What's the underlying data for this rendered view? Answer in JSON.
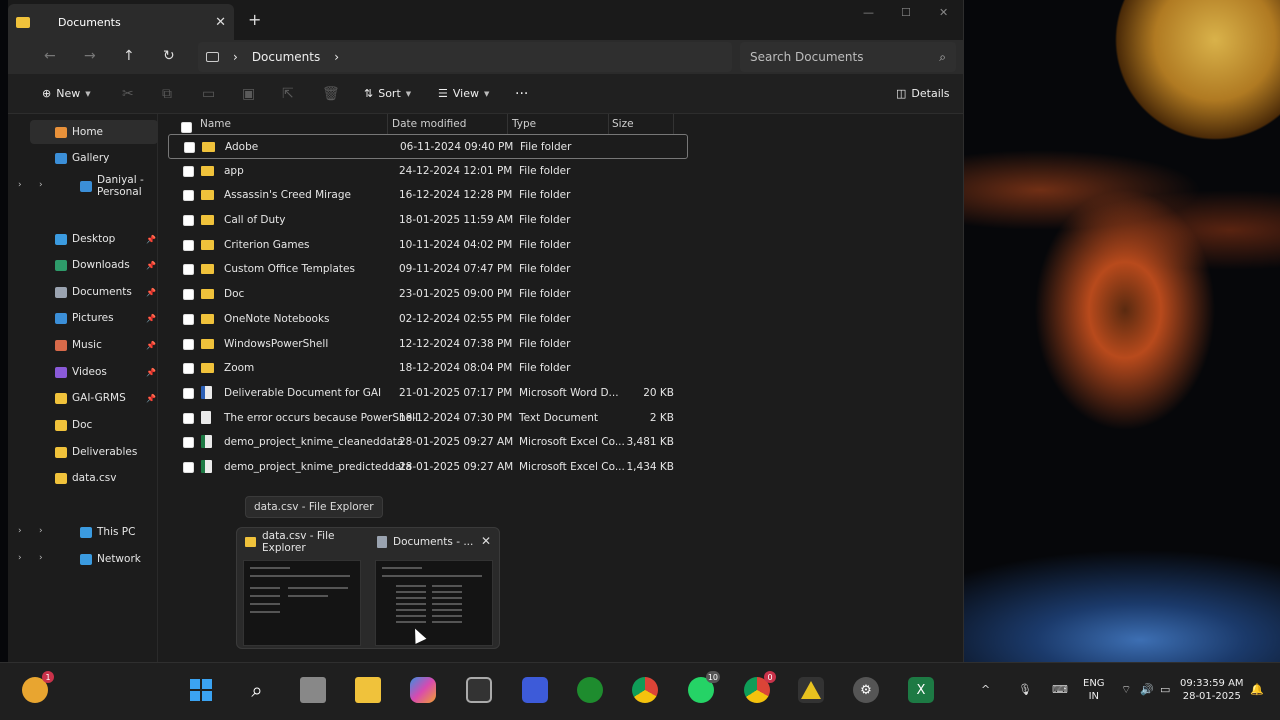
{
  "window": {
    "tab_title": "Documents",
    "new_tab": "+",
    "close_tab": "✕"
  },
  "address": {
    "breadcrumb": "Documents",
    "search_placeholder": "Search Documents"
  },
  "toolbar": {
    "new_label": "New",
    "sort_label": "Sort",
    "view_label": "View",
    "more_label": "···",
    "details_label": "Details"
  },
  "sidebar": {
    "items": [
      {
        "label": "Home",
        "icon": "home-icon",
        "color": "#e8913a"
      },
      {
        "label": "Gallery",
        "icon": "gallery-icon",
        "color": "#3b8fd8"
      },
      {
        "label": "Daniyal - Personal",
        "icon": "onedrive-icon",
        "color": "#3b8fd8"
      },
      {
        "label": "Desktop",
        "icon": "desktop-icon",
        "color": "#3b9be0"
      },
      {
        "label": "Downloads",
        "icon": "downloads-icon",
        "color": "#2e9b6a"
      },
      {
        "label": "Documents",
        "icon": "documents-icon",
        "color": "#9aa3b0"
      },
      {
        "label": "Pictures",
        "icon": "pictures-icon",
        "color": "#3b8fd8"
      },
      {
        "label": "Music",
        "icon": "music-icon",
        "color": "#d86a4a"
      },
      {
        "label": "Videos",
        "icon": "videos-icon",
        "color": "#8a5ad8"
      },
      {
        "label": "GAI-GRMS",
        "icon": "folder-icon",
        "color": "#f0c23b"
      },
      {
        "label": "Doc",
        "icon": "folder-icon",
        "color": "#f0c23b"
      },
      {
        "label": "Deliverables",
        "icon": "folder-icon",
        "color": "#f0c23b"
      },
      {
        "label": "data.csv",
        "icon": "folder-icon",
        "color": "#f0c23b"
      },
      {
        "label": "This PC",
        "icon": "pc-icon",
        "color": "#3b9be0"
      },
      {
        "label": "Network",
        "icon": "network-icon",
        "color": "#3b9be0"
      }
    ]
  },
  "columns": {
    "name": "Name",
    "date": "Date modified",
    "type": "Type",
    "size": "Size"
  },
  "files": [
    {
      "name": "Adobe",
      "date": "06-11-2024 09:40 PM",
      "type": "File folder",
      "size": "",
      "icon": "folder"
    },
    {
      "name": "app",
      "date": "24-12-2024 12:01 PM",
      "type": "File folder",
      "size": "",
      "icon": "folder"
    },
    {
      "name": "Assassin's Creed Mirage",
      "date": "16-12-2024 12:28 PM",
      "type": "File folder",
      "size": "",
      "icon": "folder"
    },
    {
      "name": "Call of Duty",
      "date": "18-01-2025 11:59 AM",
      "type": "File folder",
      "size": "",
      "icon": "folder"
    },
    {
      "name": "Criterion Games",
      "date": "10-11-2024 04:02 PM",
      "type": "File folder",
      "size": "",
      "icon": "folder"
    },
    {
      "name": "Custom Office Templates",
      "date": "09-11-2024 07:47 PM",
      "type": "File folder",
      "size": "",
      "icon": "folder"
    },
    {
      "name": "Doc",
      "date": "23-01-2025 09:00 PM",
      "type": "File folder",
      "size": "",
      "icon": "folder"
    },
    {
      "name": "OneNote Notebooks",
      "date": "02-12-2024 02:55 PM",
      "type": "File folder",
      "size": "",
      "icon": "folder"
    },
    {
      "name": "WindowsPowerShell",
      "date": "12-12-2024 07:38 PM",
      "type": "File folder",
      "size": "",
      "icon": "folder"
    },
    {
      "name": "Zoom",
      "date": "18-12-2024 08:04 PM",
      "type": "File folder",
      "size": "",
      "icon": "folder"
    },
    {
      "name": "Deliverable Document for GAI",
      "date": "21-01-2025 07:17 PM",
      "type": "Microsoft Word D...",
      "size": "20 KB",
      "icon": "word"
    },
    {
      "name": "The error occurs because PowerShell",
      "date": "18-12-2024 07:30 PM",
      "type": "Text Document",
      "size": "2 KB",
      "icon": "text"
    },
    {
      "name": "demo_project_knime_cleaneddata",
      "date": "28-01-2025 09:27 AM",
      "type": "Microsoft Excel Co...",
      "size": "3,481 KB",
      "icon": "excel"
    },
    {
      "name": "demo_project_knime_predicteddata",
      "date": "28-01-2025 09:27 AM",
      "type": "Microsoft Excel Co...",
      "size": "1,434 KB",
      "icon": "excel"
    }
  ],
  "preview": {
    "tooltip": "data.csv - File Explorer",
    "thumb1_title": "data.csv - File Explorer",
    "thumb2_title": "Documents - ..."
  },
  "taskbar": {
    "weather_badge": "1",
    "whatsapp_badge": "10",
    "chrome2_badge": "0",
    "lang_top": "ENG",
    "lang_bottom": "IN",
    "time": "09:33:59 AM",
    "date": "28-01-2025"
  }
}
